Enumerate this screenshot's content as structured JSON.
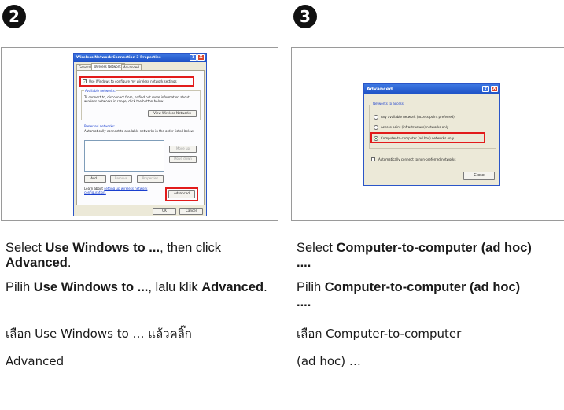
{
  "step2": {
    "number": "2",
    "dialog": {
      "title": "Wireless Network Connection 3 Properties",
      "help_btn": "?",
      "close_btn": "X",
      "tabs": [
        "General",
        "Wireless Networks",
        "Advanced"
      ],
      "use_windows_checkbox": "Use Windows to configure my wireless network settings",
      "available_group": "Available networks:",
      "available_desc": "To connect to, disconnect from, or find out more information about wireless networks in range, click the button below.",
      "view_button": "View Wireless Networks",
      "preferred_group": "Preferred networks:",
      "preferred_desc": "Automatically connect to available networks in the order listed below:",
      "move_up": "Move up",
      "move_down": "Move down",
      "add": "Add...",
      "remove": "Remove",
      "properties": "Properties",
      "learn_prefix": "Learn about",
      "learn_link": "setting up wireless network configuration.",
      "advanced_button": "Advanced",
      "ok": "OK",
      "cancel": "Cancel"
    },
    "caption_en_pre": "Select ",
    "caption_en_bold": "Use Windows to ...",
    "caption_en_mid": ", then click ",
    "caption_en_bold2": "Advanced",
    "caption_en_post": ".",
    "caption_id_pre": "Pilih ",
    "caption_id_bold": "Use Windows to ...",
    "caption_id_mid": ", lalu klik ",
    "caption_id_bold2": "Advanced",
    "caption_id_post": ".",
    "caption_th_line1": "เลือก  Use Windows to …  แล้วคลิ๊ก",
    "caption_th_line2": "Advanced"
  },
  "step3": {
    "number": "3",
    "dialog": {
      "title": "Advanced",
      "help_btn": "?",
      "close_btn": "X",
      "group": "Networks to access",
      "option1": "Any available network (access point preferred)",
      "option2": "Access point (infrastructure) networks only",
      "option3": "Computer-to-computer (ad hoc) networks only",
      "auto_connect": "Automatically connect to non-preferred networks",
      "close_button": "Close"
    },
    "caption_en_pre": "Select ",
    "caption_en_bold": "Computer-to-computer (ad hoc) ....",
    "caption_id_pre": "Pilih ",
    "caption_id_bold": "Computer-to-computer (ad hoc) ....",
    "caption_th_line1": "เลือก  Computer-to-computer",
    "caption_th_line2": "(ad hoc) …"
  },
  "colors": {
    "highlight": "#e21b1b",
    "xp_title": "#1c4fc4",
    "xp_face": "#ece9d8"
  }
}
